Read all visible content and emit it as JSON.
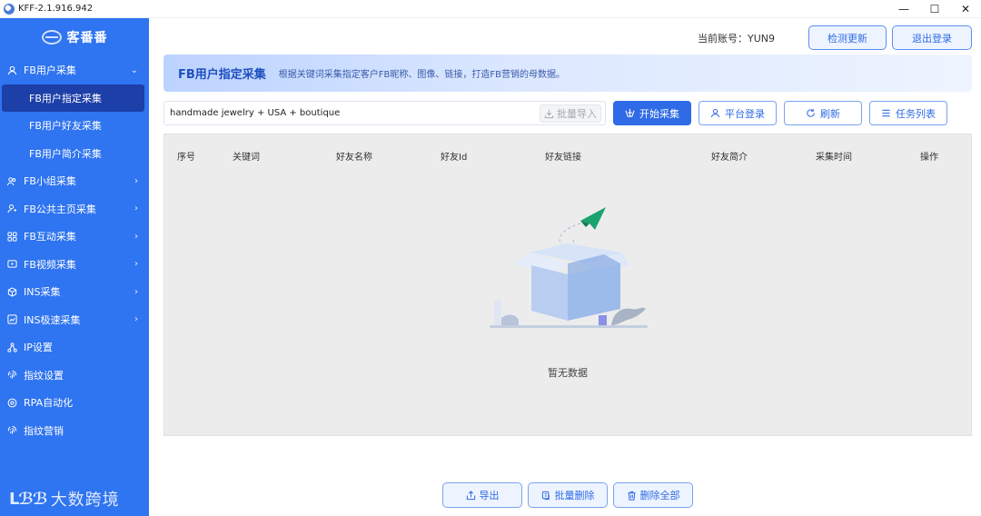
{
  "window": {
    "title": "KFF-2.1.916.942",
    "min": "—",
    "max": "☐",
    "close": "✕"
  },
  "sidebar": {
    "logo_text": "客番番",
    "items": [
      {
        "label": "FB用户采集",
        "icon": "user-icon",
        "expanded": true
      },
      {
        "label": "FB用户指定采集",
        "sub": true,
        "active": true
      },
      {
        "label": "FB用户好友采集",
        "sub": true
      },
      {
        "label": "FB用户简介采集",
        "sub": true
      },
      {
        "label": "FB小组采集",
        "icon": "group-icon"
      },
      {
        "label": "FB公共主页采集",
        "icon": "page-icon"
      },
      {
        "label": "FB互动采集",
        "icon": "interaction-icon"
      },
      {
        "label": "FB视频采集",
        "icon": "video-icon"
      },
      {
        "label": "INS采集",
        "icon": "cube-icon"
      },
      {
        "label": "INS极速采集",
        "icon": "chart-icon"
      },
      {
        "label": "IP设置",
        "icon": "network-icon"
      },
      {
        "label": "指纹设置",
        "icon": "fingerprint-icon"
      },
      {
        "label": "RPA自动化",
        "icon": "rpa-icon"
      },
      {
        "label": "指纹营销",
        "icon": "fingerprint-icon"
      }
    ],
    "brand_mark": "ᒪℬℬ",
    "brand_text": "大数跨境"
  },
  "header": {
    "account": "当前账号：YUN9",
    "check_update": "检测更新",
    "logout": "退出登录"
  },
  "banner": {
    "title": "FB用户指定采集",
    "desc": "根据关键词采集指定客户FB昵称、图像、链接，打造FB营销的母数据。"
  },
  "toolbar": {
    "keyword_value": "handmade jewelry + USA + boutique",
    "import_label": "批量导入",
    "start_label": "开始采集",
    "platform_login_label": "平台登录",
    "refresh_label": "刷新",
    "task_list_label": "任务列表"
  },
  "table": {
    "columns": [
      "序号",
      "关键词",
      "好友名称",
      "好友Id",
      "好友链接",
      "好友简介",
      "采集时间",
      "操作"
    ],
    "empty_text": "暂无数据"
  },
  "footer": {
    "export_label": "导出",
    "batch_delete_label": "批量删除",
    "delete_all_label": "删除全部"
  },
  "colors": {
    "primary": "#2f6be6",
    "sidebar": "#2f74f0",
    "active": "#1d3fa8",
    "empty_plane": "#1aa36f"
  }
}
